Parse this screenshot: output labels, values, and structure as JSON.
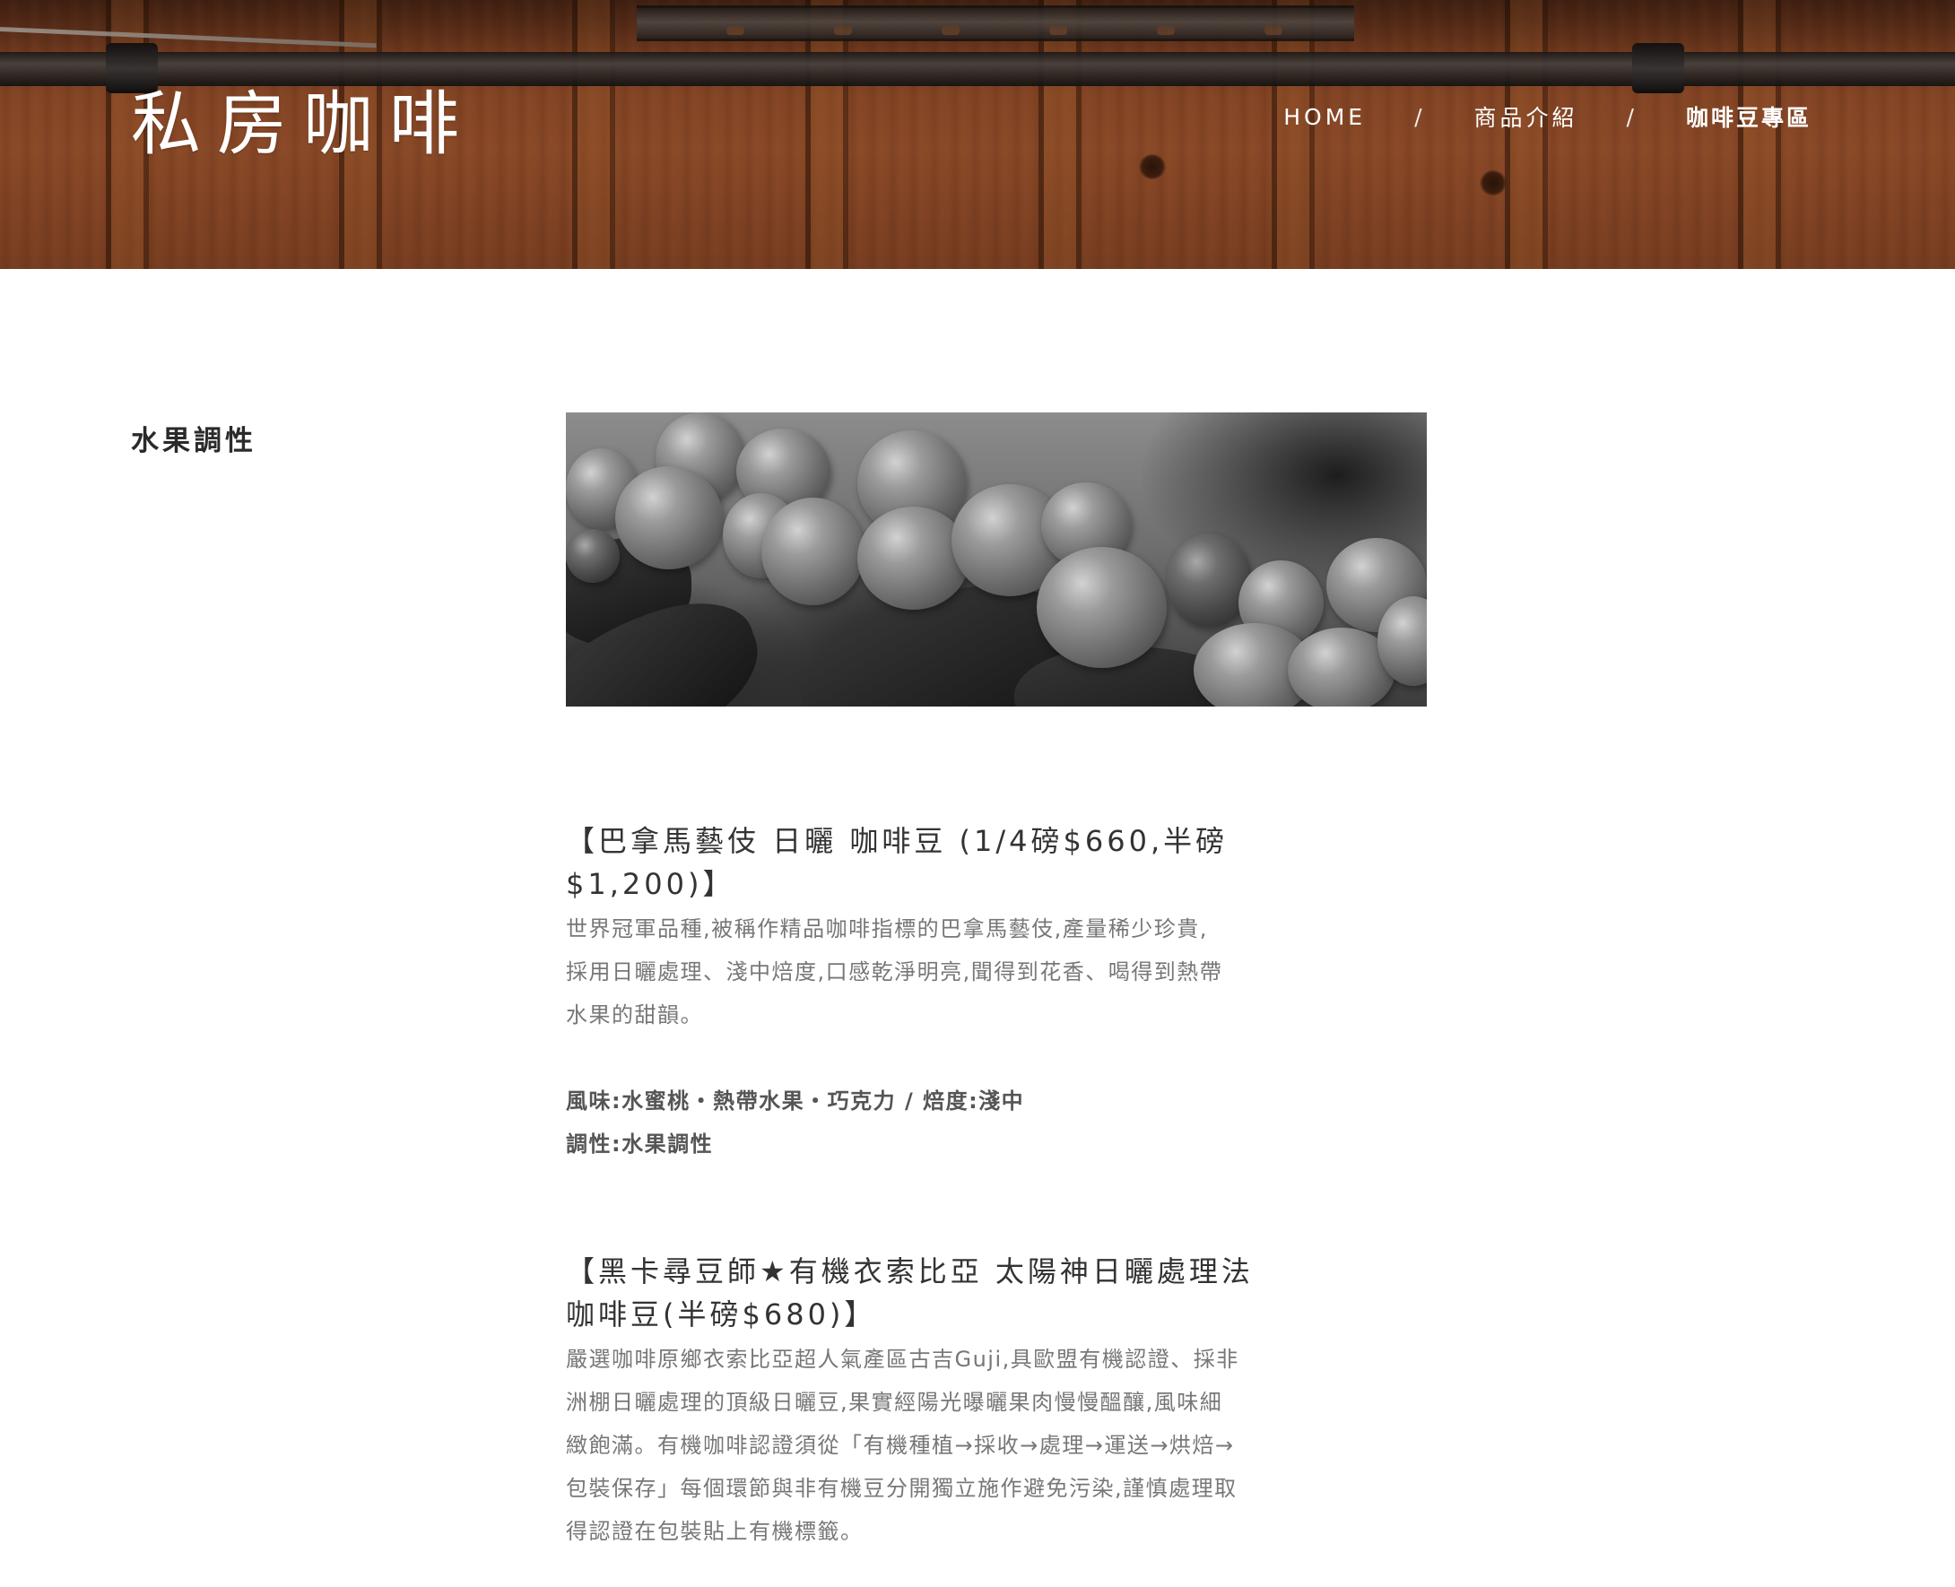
{
  "header": {
    "brand": "私房咖啡",
    "nav": {
      "home": "HOME",
      "separator": "/",
      "products": "商品介紹",
      "current": "咖啡豆專區"
    }
  },
  "category": {
    "title": "水果調性"
  },
  "products": [
    {
      "title_line1": "【巴拿馬藝伎 日曬 咖啡豆 (1/4磅$660,半磅",
      "title_line2": "$1,200)】",
      "desc_line1": "世界冠軍品種,被稱作精品咖啡指標的巴拿馬藝伎,產量稀少珍貴,",
      "desc_line2": "採用日曬處理、淺中焙度,口感乾淨明亮,聞得到花香、喝得到熱帶",
      "desc_line3": "水果的甜韻。",
      "flavor": "風味:水蜜桃・熱帶水果・巧克力 / 焙度:淺中",
      "tone": "調性:水果調性"
    },
    {
      "title_line1": "【黑卡尋豆師★有機衣索比亞 太陽神日曬處理法",
      "title_line2": "咖啡豆(半磅$680)】",
      "desc_line1": "嚴選咖啡原鄉衣索比亞超人氣產區古吉Guji,具歐盟有機認證、採非",
      "desc_line2": "洲棚日曬處理的頂級日曬豆,果實經陽光曝曬果肉慢慢醞釀,風味細",
      "desc_line3": "緻飽滿。有機咖啡認證須從「有機種植→採收→處理→運送→烘焙→",
      "desc_line4": "包裝保存」每個環節與非有機豆分開獨立施作避免污染,謹慎處理取",
      "desc_line5": "得認證在包裝貼上有機標籤。"
    }
  ]
}
